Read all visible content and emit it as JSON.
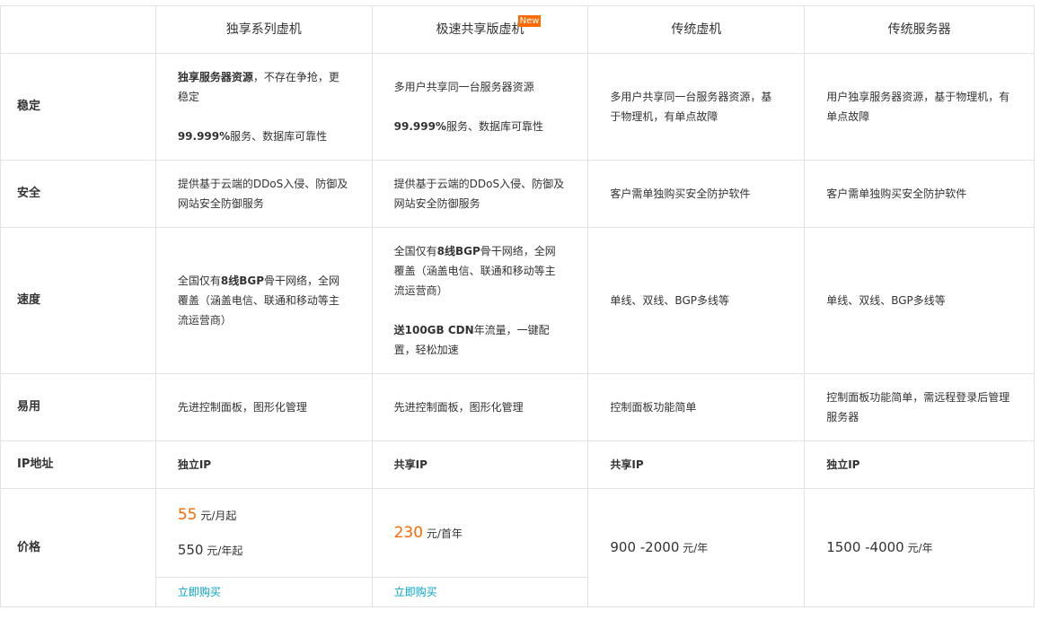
{
  "header": {
    "col1": "独享系列虚机",
    "col2": "极速共享版虚机",
    "col2_badge": "New",
    "col3": "传统虚机",
    "col4": "传统服务器"
  },
  "rows": {
    "stable": {
      "label": "稳定",
      "c1_bold": "独享服务器资源",
      "c1_rest": "，不存在争抢，更稳定",
      "c1_bold2": "99.999%",
      "c1_rest2": "服务、数据库可靠性",
      "c2_line1": "多用户共享同一台服务器资源",
      "c2_bold2": "99.999%",
      "c2_rest2": "服务、数据库可靠性",
      "c3": "多用户共享同一台服务器资源，基于物理机，有单点故障",
      "c4": "用户独享服务器资源，基于物理机，有单点故障"
    },
    "security": {
      "label": "安全",
      "c1": "提供基于云端的DDoS入侵、防御及网站安全防御服务",
      "c2": "提供基于云端的DDoS入侵、防御及网站安全防御服务",
      "c3": "客户需单独购买安全防护软件",
      "c4": "客户需单独购买安全防护软件"
    },
    "speed": {
      "label": "速度",
      "c1_pre": "全国仅有",
      "c1_bold": "8线BGP",
      "c1_rest": "骨干网络，全网覆盖（涵盖电信、联通和移动等主流运营商）",
      "c2_pre": "全国仅有",
      "c2_bold": "8线BGP",
      "c2_rest": "骨干网络，全网覆盖（涵盖电信、联通和移动等主流运营商）",
      "c2_bold2": "送100GB CDN",
      "c2_rest2": "年流量，一键配置，轻松加速",
      "c3": "单线、双线、BGP多线等",
      "c4": "单线、双线、BGP多线等"
    },
    "ease": {
      "label": "易用",
      "c1": "先进控制面板，图形化管理",
      "c2": "先进控制面板，图形化管理",
      "c3": "控制面板功能简单",
      "c4": "控制面板功能简单，需远程登录后管理服务器"
    },
    "ip": {
      "label": "IP地址",
      "c1": "独立IP",
      "c2": "共享IP",
      "c3": "共享IP",
      "c4": "独立IP"
    },
    "price": {
      "label": "价格",
      "c1_month_num": "55",
      "c1_month_unit": "元/月起",
      "c1_year_num": "550",
      "c1_year_unit": "元/年起",
      "c1_buy": "立即购买",
      "c2_num": "230",
      "c2_unit": "元/首年",
      "c2_buy": "立即购买",
      "c3_num": "900 -2000",
      "c3_unit": "元/年",
      "c4_num": "1500 -4000",
      "c4_unit": "元/年"
    }
  },
  "colors": {
    "accent": "#ff6a00",
    "link": "#00a2ca",
    "border": "#e3e3e3"
  }
}
